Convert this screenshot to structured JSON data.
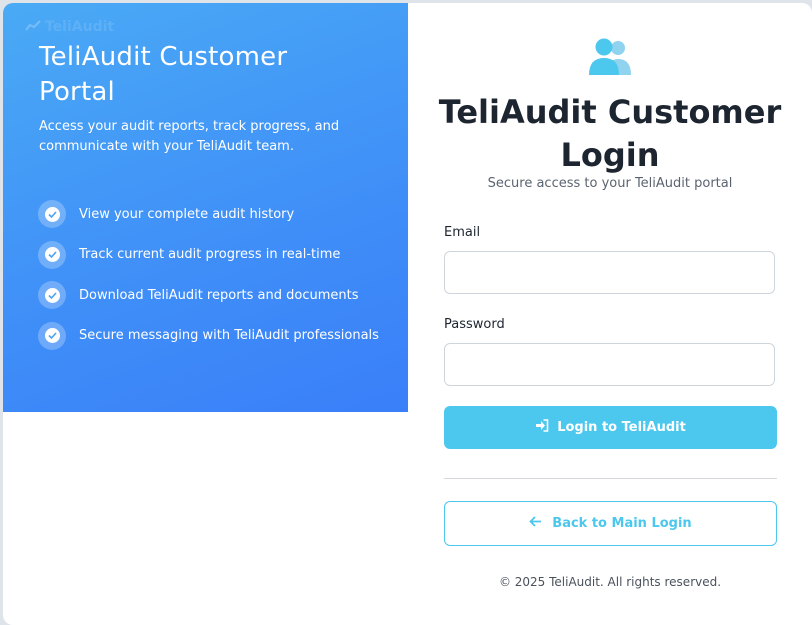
{
  "brand": {
    "watermark": "TeliAudit"
  },
  "left_panel": {
    "title": "TeliAudit Customer Portal",
    "description": "Access your audit reports, track progress, and communicate with your TeliAudit team.",
    "features": [
      "View your complete audit history",
      "Track current audit progress in real-time",
      "Download TeliAudit reports and documents",
      "Secure messaging with TeliAudit professionals"
    ]
  },
  "login": {
    "title": "TeliAudit Customer Login",
    "subtitle": "Secure access to your TeliAudit portal",
    "email_label": "Email",
    "email_value": "",
    "password_label": "Password",
    "password_value": "",
    "submit_label": "Login to TeliAudit",
    "back_label": "Back to Main Login"
  },
  "footer": {
    "copyright": "© 2025 TeliAudit. All rights reserved."
  },
  "colors": {
    "accent": "#4cc7ee",
    "gradient_start": "#4aaaf5",
    "gradient_end": "#3a7ff9"
  },
  "icons": {
    "header": "users-icon",
    "feature": "check-circle-icon",
    "submit": "sign-in-icon",
    "back": "arrow-left-icon"
  }
}
